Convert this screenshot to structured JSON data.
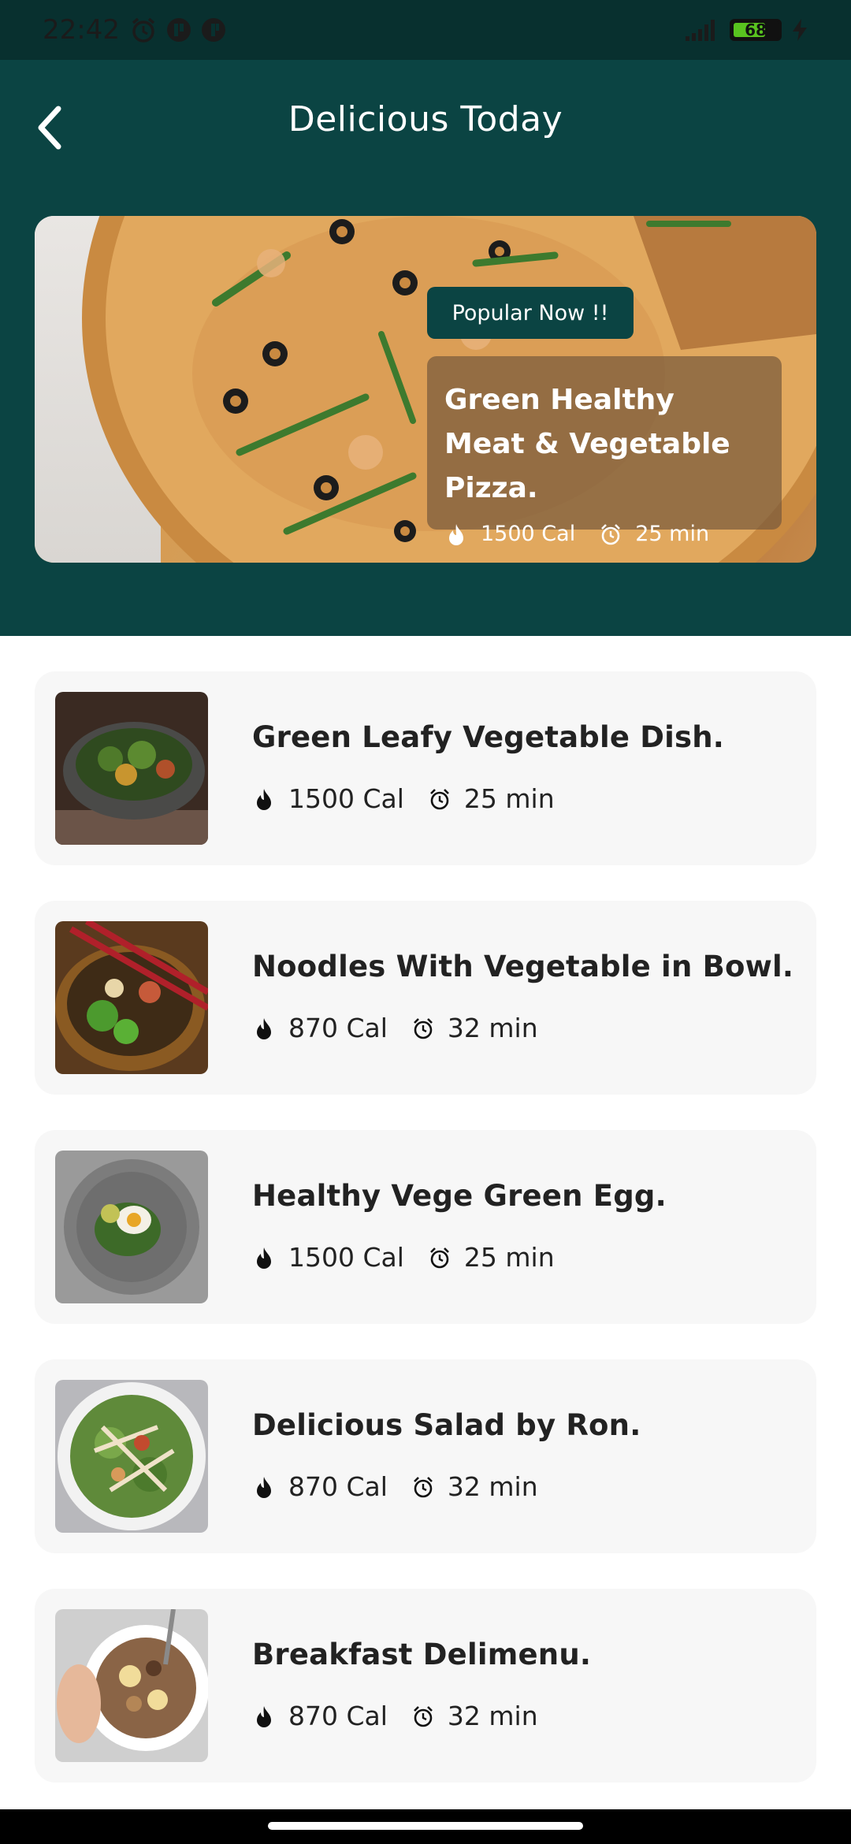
{
  "status_bar": {
    "time": "22:42",
    "battery_level": "68",
    "icons": [
      "alarm-icon",
      "app-icon-1",
      "app-icon-2",
      "signal-icon",
      "battery-icon",
      "charging-icon"
    ]
  },
  "header": {
    "title": "Delicious Today",
    "back_icon": "chevron-left-icon"
  },
  "hero": {
    "badge": "Popular Now !!",
    "name": "Green Healthy Meat & Vegetable Pizza.",
    "calories": "1500 Cal",
    "time": "25 min"
  },
  "recipes": [
    {
      "name": "Green Leafy Vegetable Dish.",
      "calories": "1500 Cal",
      "time": "25 min"
    },
    {
      "name": "Noodles With Vegetable in Bowl.",
      "calories": "870 Cal",
      "time": "32 min"
    },
    {
      "name": "Healthy Vege Green Egg.",
      "calories": "1500 Cal",
      "time": "25 min"
    },
    {
      "name": "Delicious Salad by Ron.",
      "calories": "870 Cal",
      "time": "32 min"
    },
    {
      "name": "Breakfast Delimenu.",
      "calories": "870 Cal",
      "time": "32 min"
    }
  ],
  "colors": {
    "primary": "#0b4443",
    "status_bar": "#08302f",
    "card_bg": "#f7f7f7",
    "battery_green": "#59c31f"
  }
}
